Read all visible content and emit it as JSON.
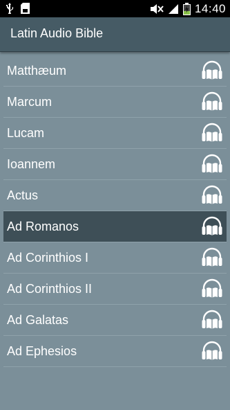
{
  "status_bar": {
    "time": "14:40",
    "icons": [
      "usb-icon",
      "sd-card-icon",
      "mute-icon",
      "signal-icon",
      "battery-charging-icon"
    ]
  },
  "app": {
    "title": "Latin Audio Bible"
  },
  "books": [
    {
      "label": "Matthæum",
      "selected": false
    },
    {
      "label": "Marcum",
      "selected": false
    },
    {
      "label": "Lucam",
      "selected": false
    },
    {
      "label": "Ioannem",
      "selected": false
    },
    {
      "label": "Actus",
      "selected": false
    },
    {
      "label": "Ad Romanos",
      "selected": true
    },
    {
      "label": "Ad Corinthios I",
      "selected": false
    },
    {
      "label": "Ad Corinthios II",
      "selected": false
    },
    {
      "label": "Ad Galatas",
      "selected": false
    },
    {
      "label": "Ad Ephesios",
      "selected": false
    }
  ],
  "colors": {
    "background": "#7b8f99",
    "action_bar": "#465b65",
    "selected_row": "#3e4f57",
    "text": "#ffffff"
  }
}
